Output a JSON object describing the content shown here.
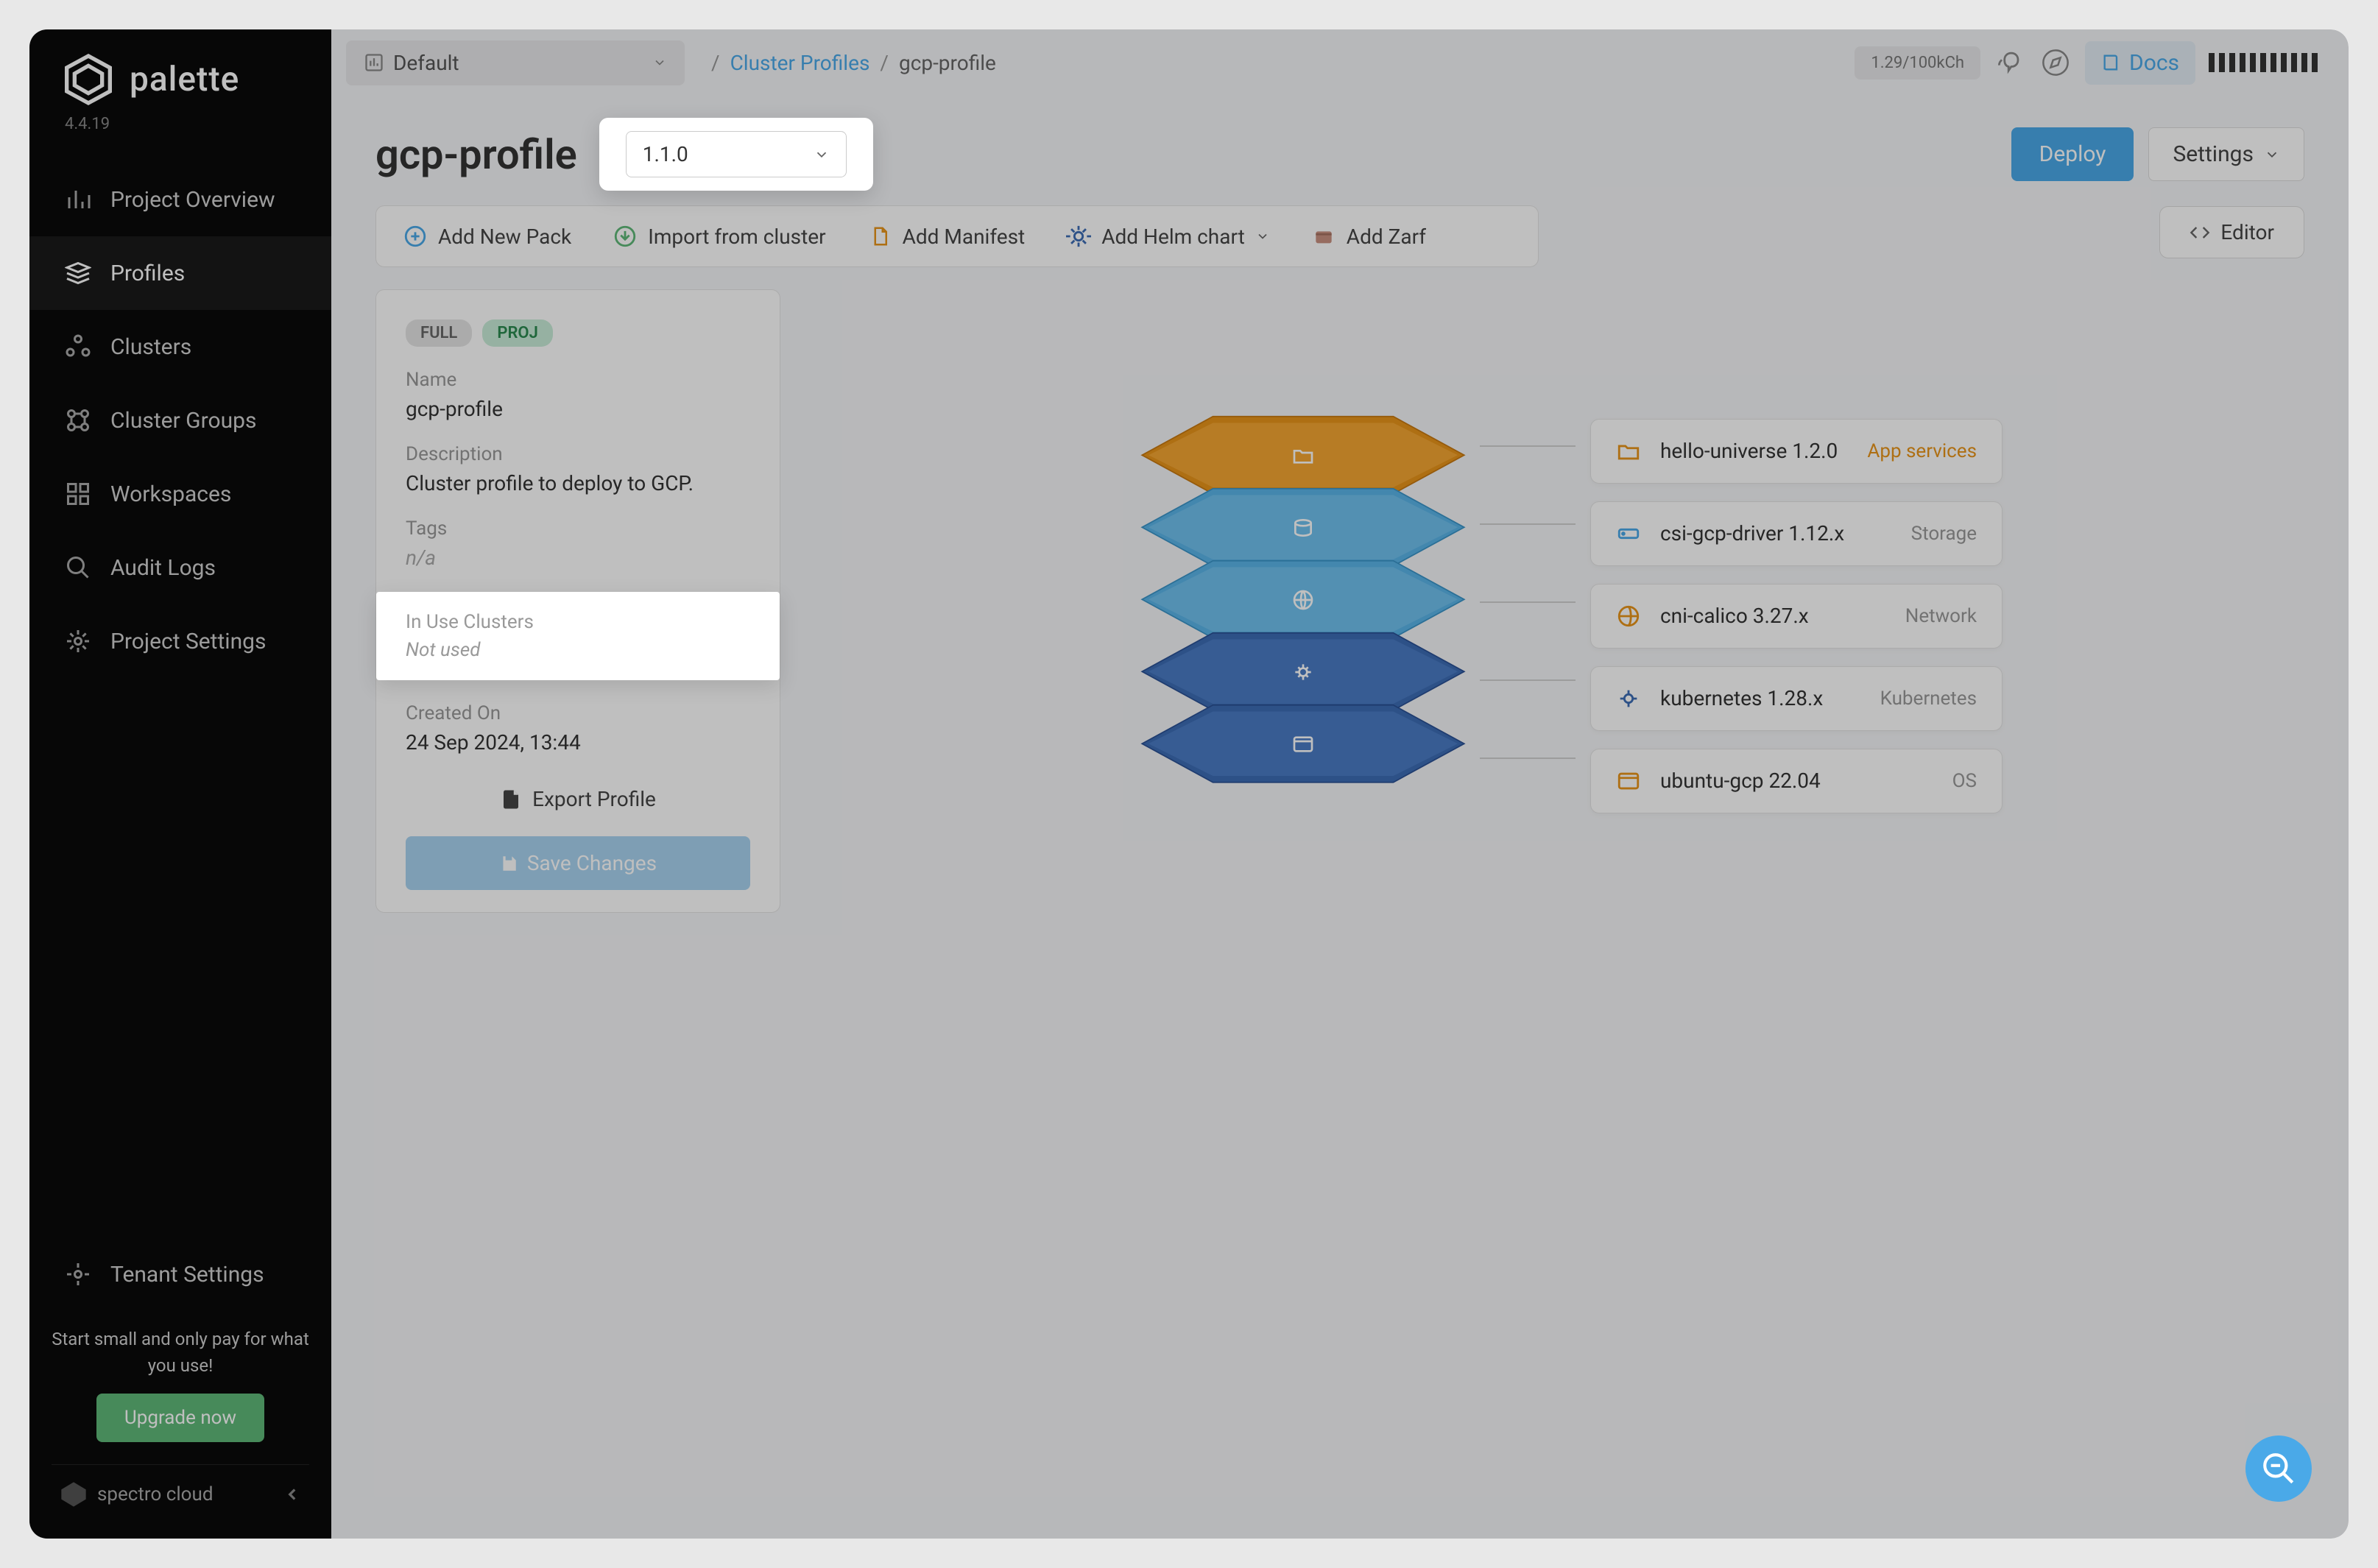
{
  "brand": {
    "name": "palette",
    "version": "4.4.19",
    "footer": "spectro cloud"
  },
  "sidebar": {
    "items": [
      {
        "label": "Project Overview"
      },
      {
        "label": "Profiles"
      },
      {
        "label": "Clusters"
      },
      {
        "label": "Cluster Groups"
      },
      {
        "label": "Workspaces"
      },
      {
        "label": "Audit Logs"
      },
      {
        "label": "Project Settings"
      }
    ],
    "tenant": "Tenant Settings",
    "upgrade_text": "Start small and only pay for what you use!",
    "upgrade_btn": "Upgrade now"
  },
  "topbar": {
    "scope": "Default",
    "breadcrumb_parent": "Cluster Profiles",
    "breadcrumb_current": "gcp-profile",
    "billing": "1.29/100kCh",
    "docs": "Docs"
  },
  "page": {
    "title": "gcp-profile",
    "version": "1.1.0",
    "deploy": "Deploy",
    "settings": "Settings"
  },
  "actions": {
    "add_pack": "Add New Pack",
    "import": "Import from cluster",
    "add_manifest": "Add Manifest",
    "add_helm": "Add Helm chart",
    "add_zarf": "Add Zarf",
    "editor": "Editor"
  },
  "info": {
    "badge_full": "FULL",
    "badge_proj": "PROJ",
    "name_label": "Name",
    "name_value": "gcp-profile",
    "desc_label": "Description",
    "desc_value": "Cluster profile to deploy to GCP.",
    "tags_label": "Tags",
    "tags_value": "n/a",
    "inuse_label": "In Use Clusters",
    "inuse_value": "Not used",
    "created_label": "Created On",
    "created_value": "24 Sep 2024, 13:44",
    "export": "Export Profile",
    "save": "Save Changes"
  },
  "layers": [
    {
      "name": "hello-universe 1.2.0",
      "type": "App services",
      "color": "#e8951a",
      "icon": "folder"
    },
    {
      "name": "csi-gcp-driver 1.12.x",
      "type": "Storage",
      "color": "#4aa9e8",
      "icon": "disk"
    },
    {
      "name": "cni-calico 3.27.x",
      "type": "Network",
      "color": "#4aa9e8",
      "icon": "globe"
    },
    {
      "name": "kubernetes 1.28.x",
      "type": "Kubernetes",
      "color": "#3d6db5",
      "icon": "helm"
    },
    {
      "name": "ubuntu-gcp 22.04",
      "type": "OS",
      "color": "#3d6db5",
      "icon": "os"
    }
  ]
}
